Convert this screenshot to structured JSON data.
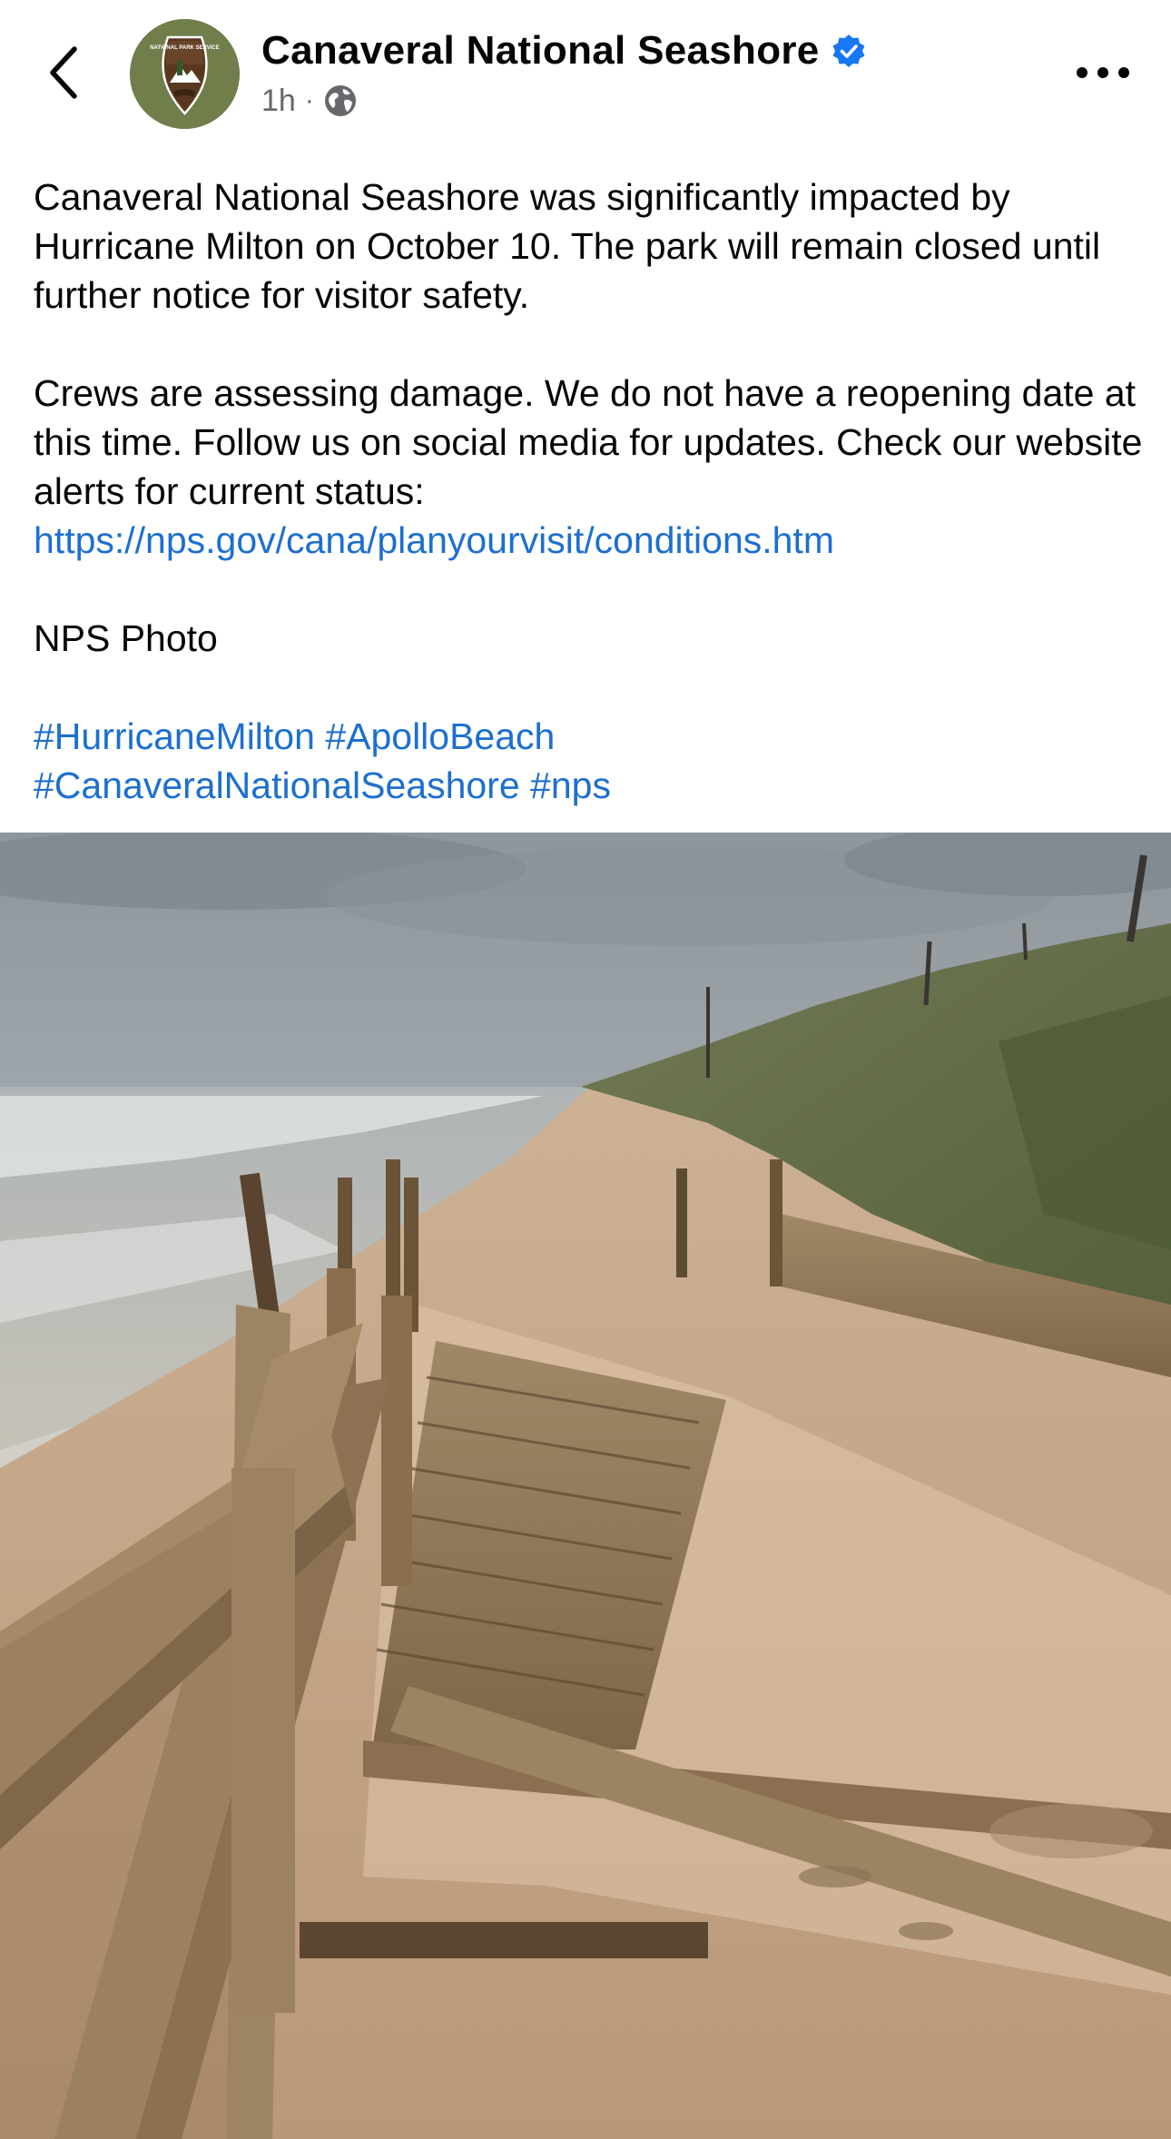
{
  "header": {
    "page_name": "Canaveral National Seashore",
    "time": "1h",
    "separator": "·",
    "avatar_text": "NATIONAL PARK SERVICE"
  },
  "icons": {
    "back": "chevron-left-icon",
    "verified": "verified-badge-icon",
    "privacy": "globe-icon",
    "more": "more-horizontal-icon"
  },
  "post": {
    "paragraph1": "Canaveral National Seashore was significantly impacted by Hurricane Milton on October 10. The park will remain closed until further notice for visitor safety.",
    "paragraph2_text": "Crews are assessing damage. We do not have a reopening date at this time. Follow us on social media for updates. Check our website alerts for current status: ",
    "paragraph2_link": "https://nps.gov/cana/planyourvisit/conditions.htm",
    "paragraph3": "NPS Photo",
    "hashtags": [
      "#HurricaneMilton",
      "#ApolloBeach",
      "#CanaveralNationalSeashore",
      "#nps"
    ]
  },
  "colors": {
    "text": "#050505",
    "secondary_text": "#65676b",
    "link": "#1d6fd1",
    "verified": "#1877f2"
  }
}
